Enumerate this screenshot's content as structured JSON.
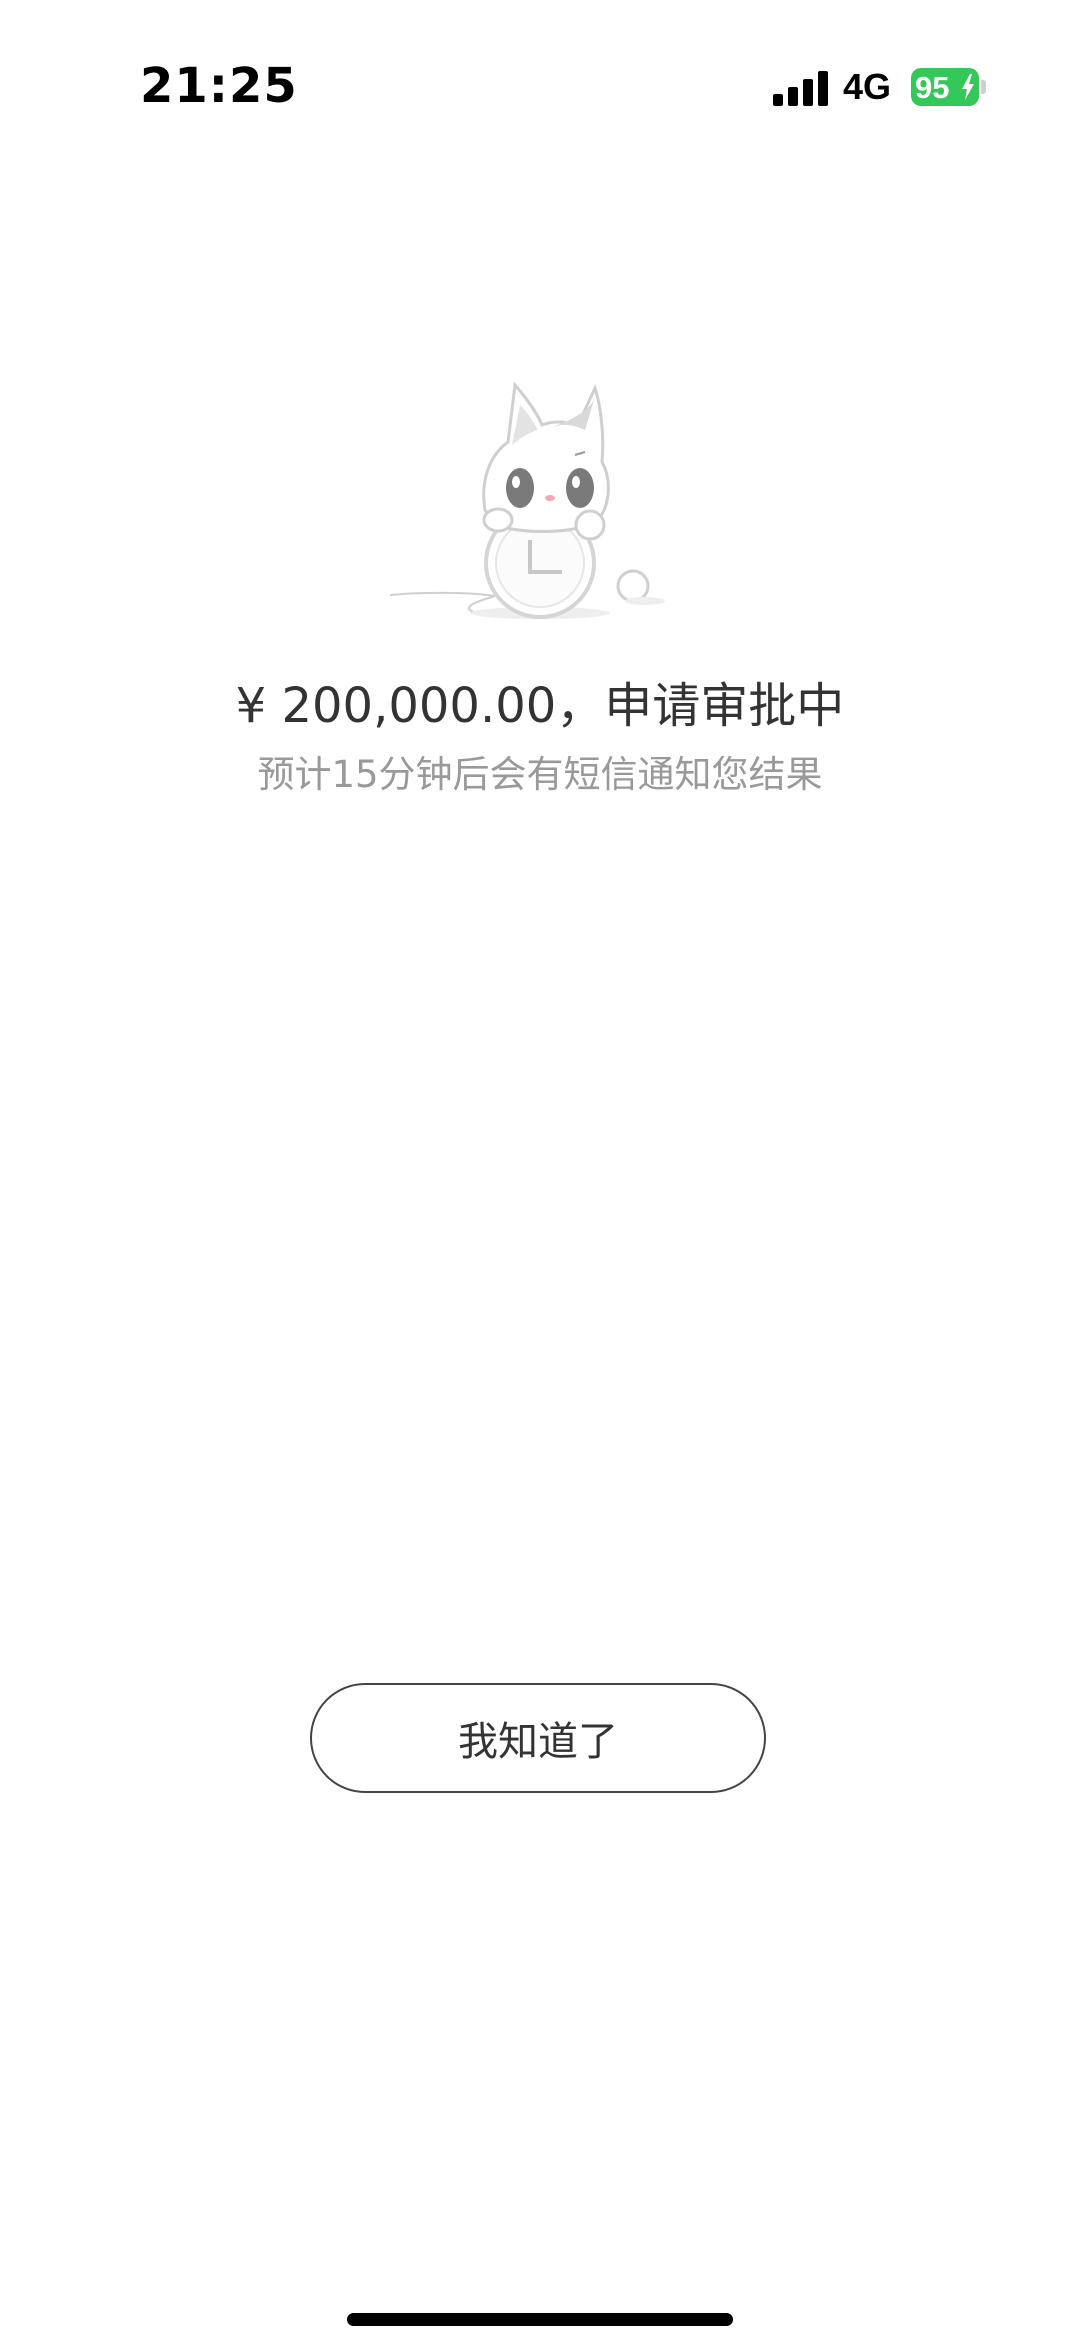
{
  "status_bar": {
    "time": "21:25",
    "network": "4G",
    "battery_level": "95",
    "battery_color": "#34c759"
  },
  "illustration": {
    "icon": "cat-with-clock-icon"
  },
  "result": {
    "amount_text": "¥ 200,000.00，申请审批中",
    "notice_text": "预计15分钟后会有短信通知您结果"
  },
  "actions": {
    "ok_label": "我知道了"
  }
}
